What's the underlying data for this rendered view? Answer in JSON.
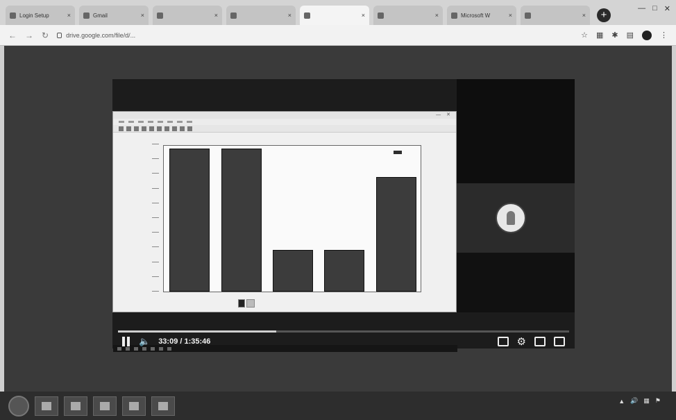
{
  "tabs": [
    {
      "title": "Login Setup",
      "active": false
    },
    {
      "title": "Gmail",
      "active": false
    },
    {
      "title": "",
      "active": false
    },
    {
      "title": "",
      "active": false
    },
    {
      "title": "",
      "active": true
    },
    {
      "title": "",
      "active": false
    },
    {
      "title": "Microsoft W",
      "active": false
    },
    {
      "title": "",
      "active": false
    }
  ],
  "new_tab_label": "+",
  "address": {
    "url": "drive.google.com/file/d/..."
  },
  "shared_chart": {
    "title": "",
    "ylabel": "",
    "legend": ""
  },
  "chart_data": {
    "type": "bar",
    "categories": [
      "",
      "",
      "",
      "",
      ""
    ],
    "values": [
      100,
      100,
      29,
      29,
      80
    ],
    "ylim": [
      0,
      100
    ],
    "title": "",
    "xlabel": "",
    "ylabel": "",
    "legend_position": "top-right",
    "grid": false
  },
  "player": {
    "time": "33:09 / 1:35:46",
    "progress": 0.35,
    "participant_name": ""
  },
  "taskbar": {
    "clock_time": "",
    "clock_date": ""
  },
  "colors": {
    "bar": "#3c3c3c",
    "background": "#3a3a3a"
  }
}
